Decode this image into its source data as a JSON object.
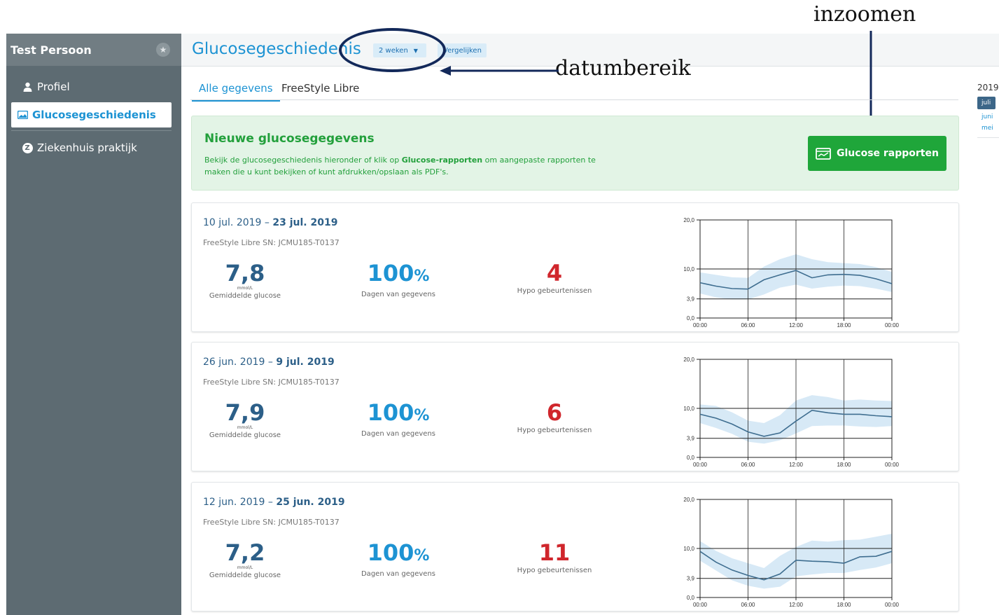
{
  "sidebar": {
    "user_name": "Test Persoon",
    "items": [
      {
        "label": "Profiel",
        "icon": "person-icon"
      },
      {
        "label": "Glucosegeschiedenis",
        "icon": "image-icon",
        "active": true
      },
      {
        "label": "Ziekenhuis praktijk",
        "icon": "z-badge-icon",
        "badge": "Z"
      }
    ]
  },
  "header": {
    "title": "Glucosegeschiedenis",
    "range_value": "2 weken",
    "compare_label": "Vergelijken"
  },
  "annotations": {
    "range": "datumbereik",
    "zoom": "inzoomen"
  },
  "tabs": [
    "Alle gegevens",
    "FreeStyle Libre"
  ],
  "banner": {
    "title": "Nieuwe glucosegegevens",
    "text_before": "Bekijk de glucosegeschiedenis hieronder of klik op ",
    "text_link": "Glucose-rapporten",
    "text_after": " om aangepaste rapporten te maken die u kunt bekijken of kunt afdrukken/opslaan als PDF's.",
    "button_label": "Glucose rapporten"
  },
  "labels": {
    "unit": "mmol/L",
    "avg": "Gemiddelde glucose",
    "days": "Dagen van gegevens",
    "hypo": "Hypo gebeurtenissen",
    "percent": "%"
  },
  "periods": [
    {
      "start": "10 jul. 2019",
      "end": "23 jul. 2019",
      "device": "FreeStyle Libre  SN: JCMU185-T0137",
      "avg": "7,8",
      "days": "100",
      "hypo": "4"
    },
    {
      "start": "26 jun. 2019",
      "end": "9 jul. 2019",
      "device": "FreeStyle Libre  SN: JCMU185-T0137",
      "avg": "7,9",
      "days": "100",
      "hypo": "6"
    },
    {
      "start": "12 jun. 2019",
      "end": "25 jun. 2019",
      "device": "FreeStyle Libre  SN: JCMU185-T0137",
      "avg": "7,2",
      "days": "100",
      "hypo": "11"
    }
  ],
  "rail": {
    "year": "2019",
    "months": [
      "juli",
      "juni",
      "mei"
    ]
  },
  "chart_data": [
    {
      "type": "area",
      "x": [
        "00:00",
        "02:00",
        "04:00",
        "06:00",
        "08:00",
        "10:00",
        "12:00",
        "14:00",
        "16:00",
        "18:00",
        "20:00",
        "22:00",
        "24:00"
      ],
      "xticks": [
        "00:00",
        "06:00",
        "12:00",
        "18:00",
        "00:00"
      ],
      "yticks": [
        "0,0",
        "3,9",
        "10,0",
        "20,0"
      ],
      "ylim": [
        0,
        20
      ],
      "series": [
        {
          "values": [
            7.2,
            6.5,
            6.0,
            5.9,
            7.8,
            8.8,
            9.7,
            8.2,
            8.8,
            8.9,
            8.7,
            8.0,
            7.0
          ]
        },
        {
          "values": [
            5.0,
            4.2,
            3.8,
            3.8,
            4.8,
            6.2,
            6.8,
            6.0,
            6.4,
            6.6,
            6.5,
            6.0,
            5.3
          ]
        },
        {
          "values": [
            9.3,
            8.8,
            8.3,
            8.2,
            10.5,
            12.0,
            13.0,
            12.0,
            11.4,
            11.2,
            11.0,
            10.4,
            9.4
          ]
        }
      ],
      "colors": {
        "band": "#d7e9f6",
        "line": "#3f6e90",
        "grid": "#222222"
      }
    },
    {
      "type": "area",
      "x": [
        "00:00",
        "02:00",
        "04:00",
        "06:00",
        "08:00",
        "10:00",
        "12:00",
        "14:00",
        "16:00",
        "18:00",
        "20:00",
        "22:00",
        "24:00"
      ],
      "xticks": [
        "00:00",
        "06:00",
        "12:00",
        "18:00",
        "00:00"
      ],
      "yticks": [
        "0,0",
        "3,9",
        "10,0",
        "20,0"
      ],
      "ylim": [
        0,
        20
      ],
      "series": [
        {
          "values": [
            8.8,
            8.0,
            6.8,
            5.2,
            4.3,
            5.0,
            7.4,
            9.6,
            9.1,
            8.8,
            8.8,
            8.5,
            8.3
          ]
        },
        {
          "values": [
            7.0,
            6.0,
            4.8,
            3.2,
            2.8,
            3.5,
            4.9,
            6.4,
            6.5,
            6.5,
            6.3,
            6.2,
            6.4
          ]
        },
        {
          "values": [
            10.8,
            10.5,
            9.2,
            7.5,
            7.0,
            8.6,
            11.6,
            12.7,
            12.3,
            11.6,
            11.8,
            11.6,
            11.5
          ]
        }
      ],
      "colors": {
        "band": "#d7e9f6",
        "line": "#3f6e90",
        "grid": "#222222"
      }
    },
    {
      "type": "area",
      "x": [
        "00:00",
        "02:00",
        "04:00",
        "06:00",
        "08:00",
        "10:00",
        "12:00",
        "14:00",
        "16:00",
        "18:00",
        "20:00",
        "22:00",
        "24:00"
      ],
      "xticks": [
        "00:00",
        "06:00",
        "12:00",
        "18:00",
        "00:00"
      ],
      "yticks": [
        "0,0",
        "3,9",
        "10,0",
        "20,0"
      ],
      "ylim": [
        0,
        20
      ],
      "series": [
        {
          "values": [
            9.4,
            7.2,
            5.6,
            4.5,
            3.6,
            4.8,
            7.6,
            7.4,
            7.3,
            7.0,
            8.3,
            8.4,
            9.4
          ]
        },
        {
          "values": [
            7.5,
            5.5,
            3.5,
            2.4,
            1.8,
            2.2,
            4.3,
            4.7,
            5.0,
            5.0,
            5.6,
            6.1,
            7.0
          ]
        },
        {
          "values": [
            11.5,
            9.5,
            8.0,
            7.0,
            6.0,
            8.5,
            10.3,
            11.6,
            11.4,
            11.7,
            11.8,
            12.4,
            13.0
          ]
        }
      ],
      "colors": {
        "band": "#d7e9f6",
        "line": "#3f6e90",
        "grid": "#222222"
      }
    }
  ]
}
